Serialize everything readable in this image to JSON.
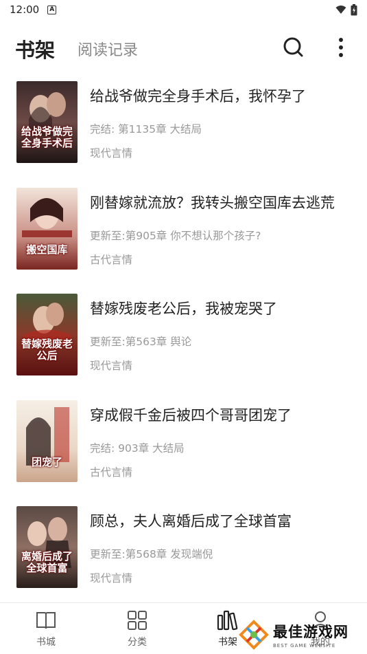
{
  "status_bar": {
    "time": "12:00",
    "notification": "A"
  },
  "header": {
    "tabs": [
      "书架",
      "阅读记录"
    ]
  },
  "books": [
    {
      "title": "给战爷做完全身手术后，我怀孕了",
      "status": "完结: 第1135章 大结局",
      "genre": "现代言情",
      "cover_text": "给战爷做完全身手术后"
    },
    {
      "title": "刚替嫁就流放？我转头搬空国库去逃荒",
      "status": "更新至:第905章 你不想认那个孩子?",
      "genre": "古代言情",
      "cover_text": "搬空国库"
    },
    {
      "title": "替嫁残废老公后，我被宠哭了",
      "status": "更新至:第563章 舆论",
      "genre": "现代言情",
      "cover_text": "替嫁残废老公后"
    },
    {
      "title": "穿成假千金后被四个哥哥团宠了",
      "status": "完结: 903章 大结局",
      "genre": "古代言情",
      "cover_text": "团宠了"
    },
    {
      "title": "顾总，夫人离婚后成了全球首富",
      "status": "更新至:第568章 发现端倪",
      "genre": "现代言情",
      "cover_text": "离婚后成了全球首富"
    }
  ],
  "bottom_nav": [
    {
      "label": "书城",
      "icon": "book-icon"
    },
    {
      "label": "分类",
      "icon": "grid-icon"
    },
    {
      "label": "书架",
      "icon": "bookshelf-icon"
    },
    {
      "label": "我的",
      "icon": "profile-icon"
    }
  ],
  "watermark": {
    "main": "最佳游戏网",
    "sub": "BEST GAME WEBSITE"
  },
  "colors": {
    "text_primary": "#222222",
    "text_secondary": "#999999",
    "tab_inactive": "#888888",
    "divider": "#e8e8e8"
  }
}
